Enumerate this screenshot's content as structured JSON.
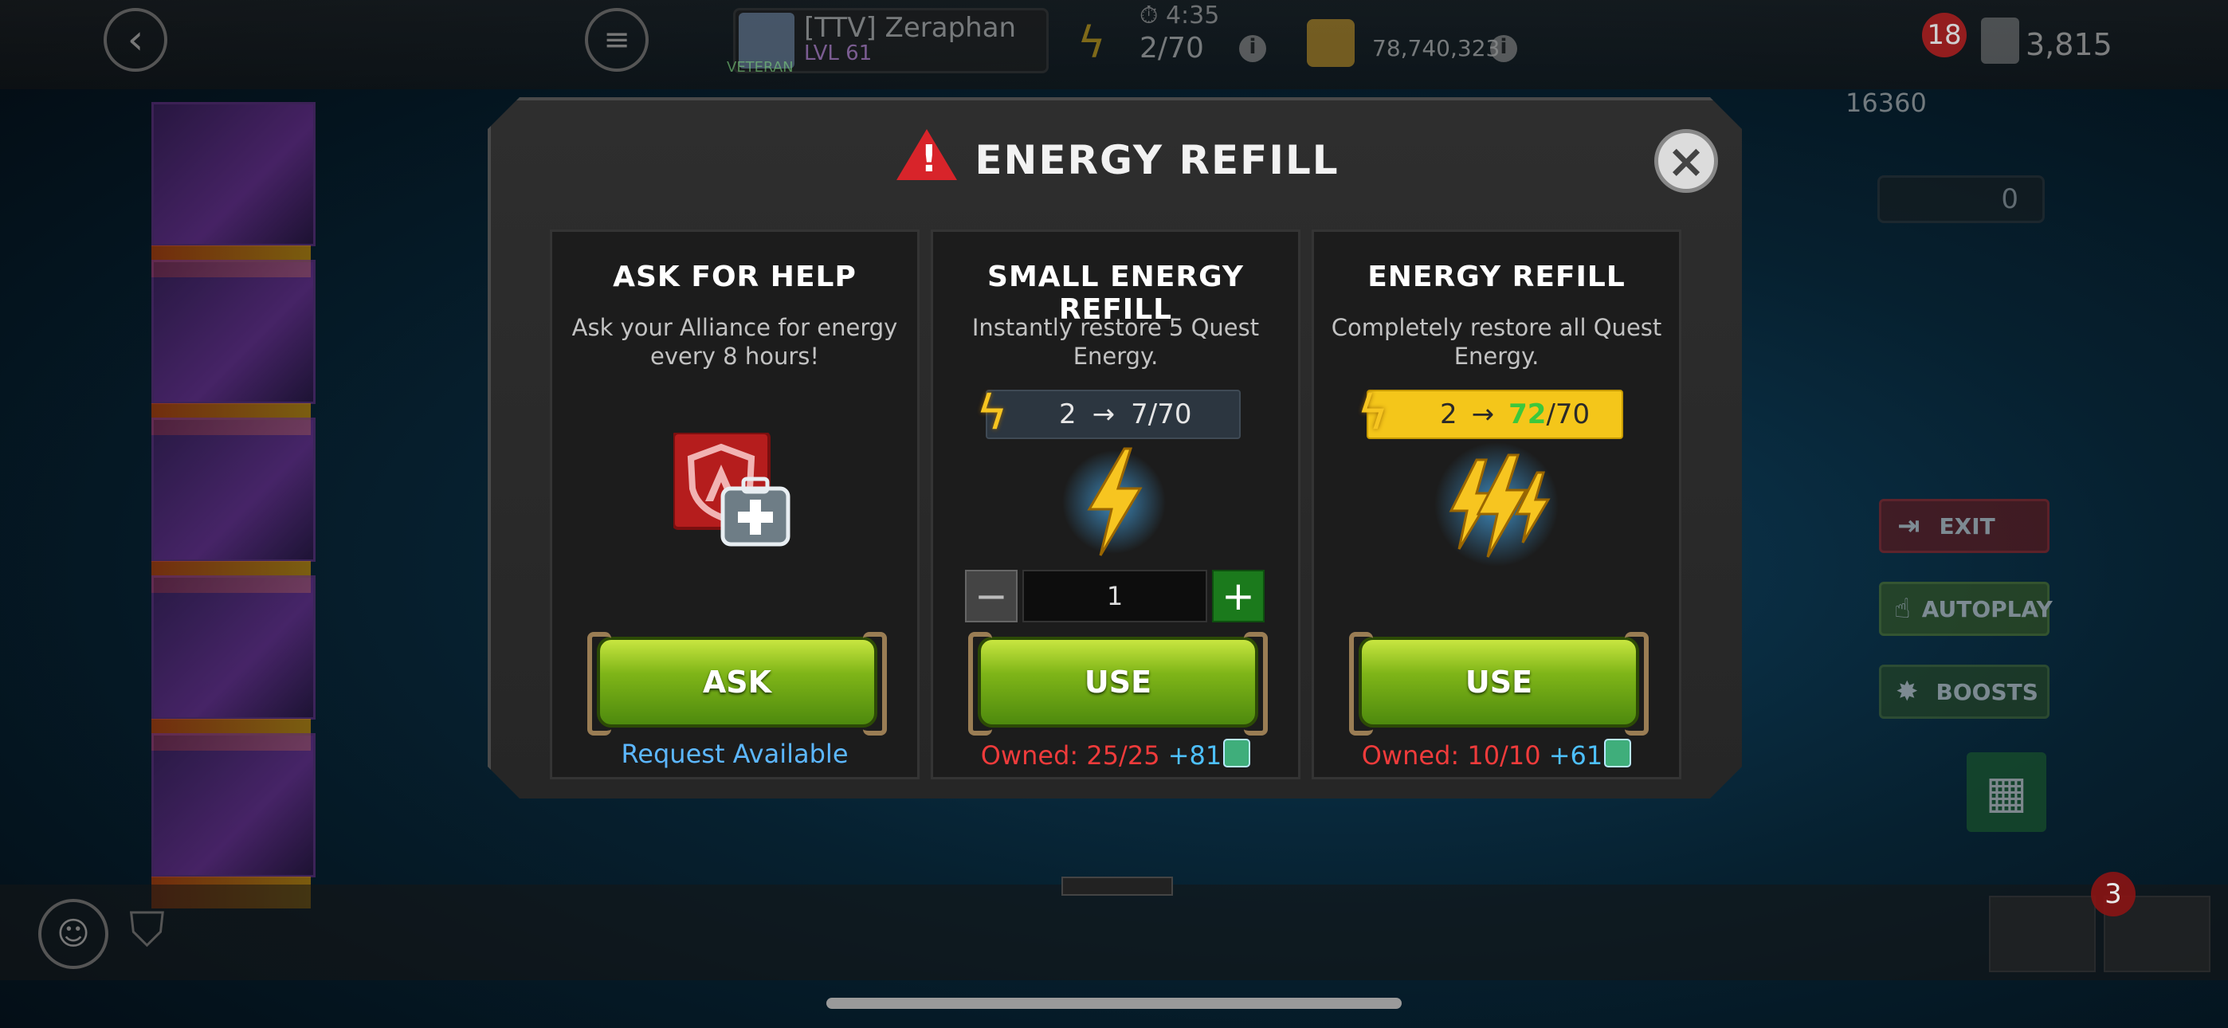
{
  "hud": {
    "player_tag": "[TTV]",
    "player_name": "Zeraphan",
    "player_level": "LVL 61",
    "veteran_label": "VETERAN",
    "energy_timer": "4:35",
    "energy_count": "2/70",
    "gold_amount": "78,740,323",
    "notification_count": "18",
    "units_amount": "3,815",
    "team_rating": "16360",
    "keys_count": "0",
    "quest_badge_count": "3"
  },
  "side_buttons": {
    "exit": "EXIT",
    "autoplay": "AUTOPLAY",
    "boosts": "BOOSTS"
  },
  "dialog": {
    "title": "ENERGY REFILL",
    "panels": [
      {
        "title": "ASK FOR HELP",
        "description": "Ask your Alliance for energy every 8 hours!",
        "button": "ASK",
        "status": "Request Available"
      },
      {
        "title": "SMALL ENERGY REFILL",
        "description": "Instantly restore 5 Quest Energy.",
        "energy_from": "2",
        "arrow": "→",
        "energy_to": "7/70",
        "quantity": "1",
        "button": "USE",
        "owned_label": "Owned: 25/25",
        "owned_extra": "+81"
      },
      {
        "title": "ENERGY REFILL",
        "description": "Completely restore all Quest Energy.",
        "energy_from": "2",
        "arrow": "→",
        "energy_to_highlight": "72",
        "energy_to_max": "/70",
        "button": "USE",
        "owned_label": "Owned: 10/10",
        "owned_extra": "+61"
      }
    ]
  },
  "colors": {
    "accent_green": "#7fb518",
    "owned_red": "#ef3b3b",
    "extra_blue": "#4ec0ff",
    "energy_yellow": "#f7c520"
  }
}
